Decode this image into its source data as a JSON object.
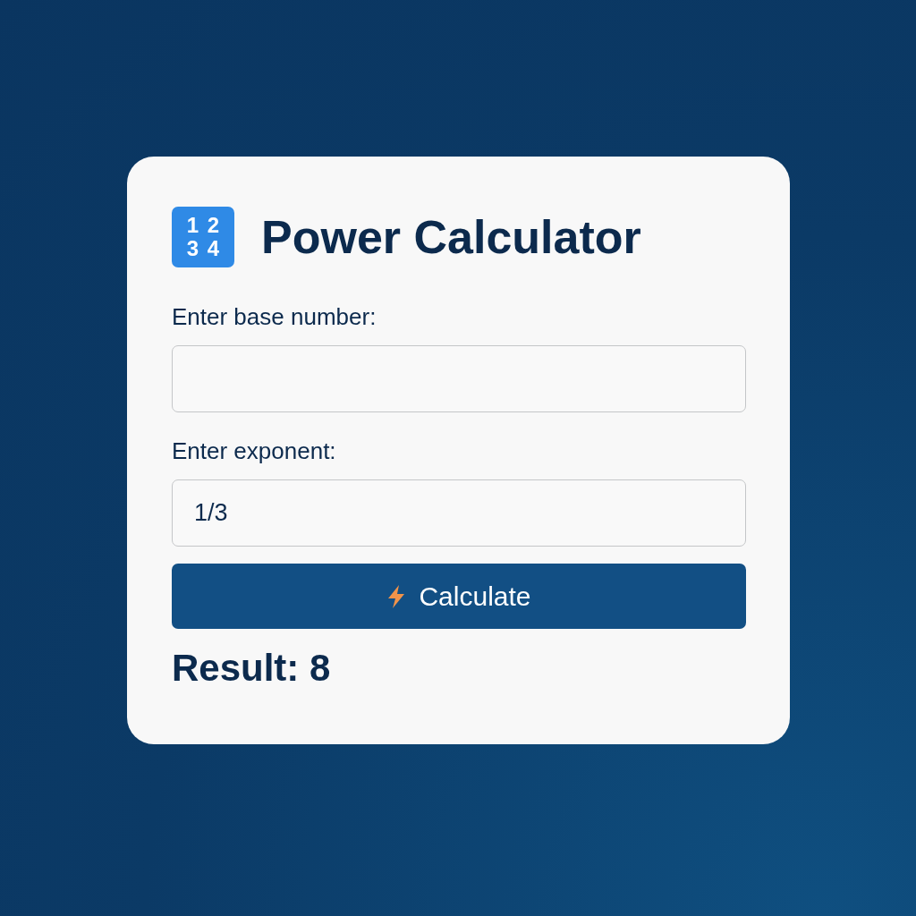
{
  "header": {
    "icon_digits": [
      "1",
      "2",
      "3",
      "4"
    ],
    "title": "Power Calculator"
  },
  "fields": [
    {
      "label": "Enter base number:"
    },
    {
      "label": "Enter exponent:",
      "value": "1/3"
    }
  ],
  "button": {
    "label": "Calculate"
  },
  "result": "Result: 8"
}
